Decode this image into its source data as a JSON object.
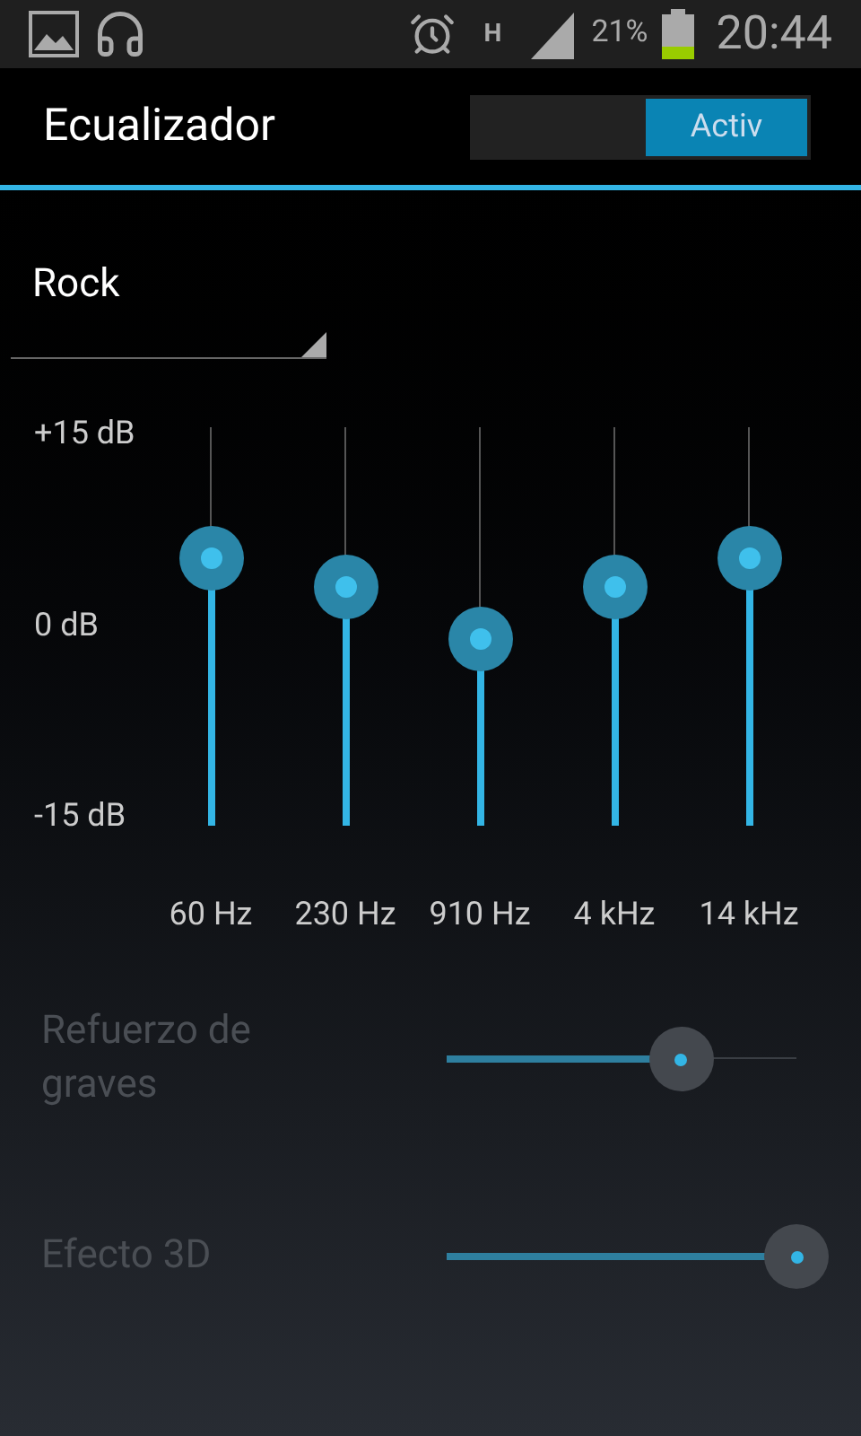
{
  "status_bar": {
    "network": "H",
    "battery": "21%",
    "time": "20:44"
  },
  "action_bar": {
    "title": "Ecualizador",
    "switch": {
      "label": "Activ",
      "on": true
    }
  },
  "preset": {
    "value": "Rock"
  },
  "equalizer": {
    "db_labels": [
      "+15 dB",
      "0 dB",
      "-15 dB"
    ],
    "bands": [
      {
        "label": "60 Hz",
        "level": 0.67
      },
      {
        "label": "230 Hz",
        "level": 0.6
      },
      {
        "label": "910 Hz",
        "level": 0.47
      },
      {
        "label": "4 kHz",
        "level": 0.6
      },
      {
        "label": "14 kHz",
        "level": 0.67
      }
    ]
  },
  "effects": [
    {
      "label": "Refuerzo de graves",
      "level": 0.67,
      "disabled": true
    },
    {
      "label": "Efecto 3D",
      "level": 1.0,
      "disabled": true
    }
  ]
}
